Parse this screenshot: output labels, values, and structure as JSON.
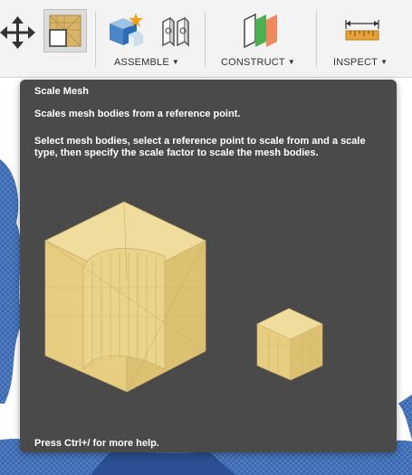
{
  "toolbar": {
    "groups": [
      {
        "label": "ASSEMBLE",
        "icon": "assemble-icon"
      },
      {
        "label": "CONSTRUCT",
        "icon": "construct-plane-icon"
      },
      {
        "label": "INSPECT",
        "icon": "measure-icon"
      }
    ],
    "tools": [
      {
        "name": "move-icon"
      },
      {
        "name": "scale-mesh-icon",
        "active": true
      },
      {
        "name": "new-component-icon"
      },
      {
        "name": "joint-icon"
      },
      {
        "name": "offset-plane-icon"
      },
      {
        "name": "measure-icon"
      }
    ]
  },
  "tooltip": {
    "title": "Scale Mesh",
    "description": "Scales mesh bodies from a reference point.",
    "detail": "Select mesh bodies, select a reference point to scale from and a scale type, then specify the scale factor to scale the mesh bodies.",
    "help": "Press Ctrl+/ for more help."
  },
  "colors": {
    "toolbar_bg": "#f3f3f3",
    "tooltip_bg": "#4a4a4a",
    "mesh_fill": "#e8d08a",
    "canvas_mesh_blue": "#2f5fa8"
  }
}
